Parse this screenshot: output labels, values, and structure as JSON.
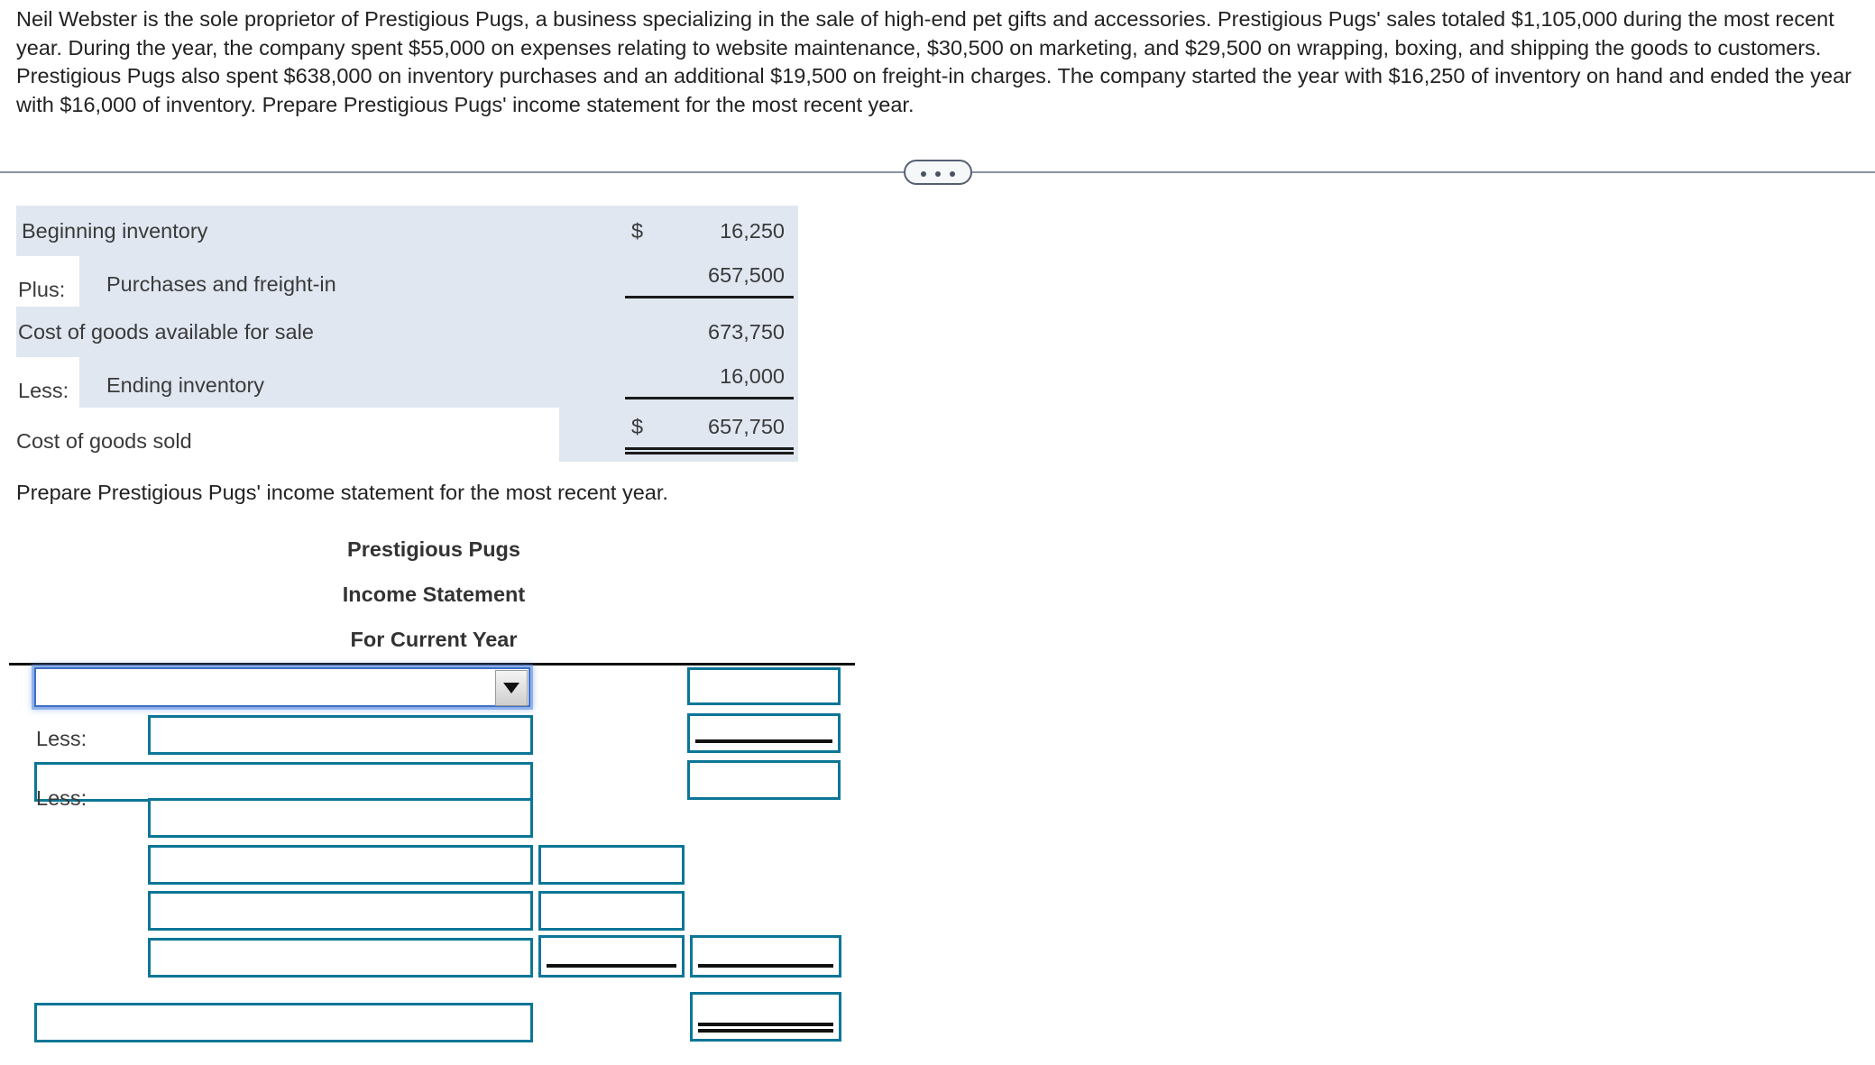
{
  "problem": {
    "statement": "Neil Webster is the sole proprietor of Prestigious Pugs, a business specializing in the sale of high-end pet gifts and accessories. Prestigious Pugs' sales totaled $1,105,000 during the most recent year. During the year, the company spent $55,000 on expenses relating to website maintenance, $30,500 on marketing, and $29,500 on wrapping, boxing, and shipping the goods to customers. Prestigious Pugs also spent $638,000 on inventory purchases and an additional $19,500 on freight-in charges. The company started the year with $16,250 of inventory on hand and ended the year with $16,000 of inventory. Prepare Prestigious Pugs' income statement for the most recent year."
  },
  "divider": {
    "icon": "ellipsis-icon",
    "dots": "..."
  },
  "cogs_schedule": {
    "rows": [
      {
        "prefix": "",
        "label": "Beginning inventory",
        "dollar": "$",
        "amount": "16,250",
        "rule": "none"
      },
      {
        "prefix": "Plus:",
        "label": "Purchases and freight-in",
        "dollar": "",
        "amount": "657,500",
        "rule": "single"
      },
      {
        "prefix": "",
        "label": "Cost of goods available for sale",
        "dollar": "",
        "amount": "673,750",
        "rule": "none"
      },
      {
        "prefix": "Less:",
        "label": "Ending inventory",
        "dollar": "",
        "amount": "16,000",
        "rule": "single"
      },
      {
        "prefix": "",
        "label": "Cost of goods sold",
        "dollar": "$",
        "amount": "657,750",
        "rule": "double"
      }
    ]
  },
  "form": {
    "prompt": "Prepare Prestigious Pugs' income statement for the most recent year.",
    "heading": {
      "company": "Prestigious Pugs",
      "title": "Income Statement",
      "period": "For Current Year"
    },
    "select": {
      "value": "",
      "placeholder": "",
      "arrow_icon": "chevron-down-icon"
    },
    "row_labels": {
      "less_1": "Less:",
      "less_2": "Less:"
    },
    "input_values": {
      "desc_2": "",
      "desc_3": "",
      "desc_4": "",
      "desc_5": "",
      "desc_6": "",
      "desc_7": "",
      "desc_8": "",
      "amt_mid_5": "",
      "amt_mid_6": "",
      "amt_mid_7": "",
      "amt_right_1": "",
      "amt_right_2": "",
      "amt_right_3": "",
      "amt_right_7": "",
      "amt_right_8": ""
    }
  },
  "colors": {
    "shade": "#e0e7f1",
    "input_border": "#0c7697",
    "focus_border": "#3f6fc4",
    "rule": "#111111",
    "divider": "#8c93a3"
  }
}
